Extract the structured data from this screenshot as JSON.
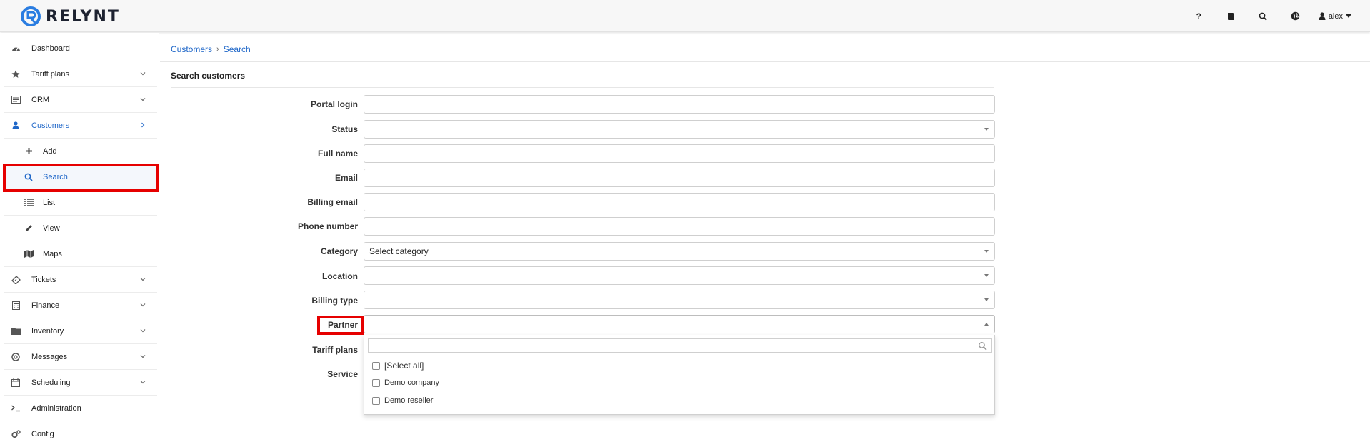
{
  "app": {
    "brand": "RELYNT"
  },
  "topbar": {
    "help": "?",
    "user": "alex"
  },
  "sidebar": {
    "items": [
      {
        "label": "Dashboard"
      },
      {
        "label": "Tariff plans"
      },
      {
        "label": "CRM"
      },
      {
        "label": "Customers"
      },
      {
        "label": "Add"
      },
      {
        "label": "Search"
      },
      {
        "label": "List"
      },
      {
        "label": "View"
      },
      {
        "label": "Maps"
      },
      {
        "label": "Tickets"
      },
      {
        "label": "Finance"
      },
      {
        "label": "Inventory"
      },
      {
        "label": "Messages"
      },
      {
        "label": "Scheduling"
      },
      {
        "label": "Administration"
      },
      {
        "label": "Config"
      }
    ]
  },
  "breadcrumb": {
    "parent": "Customers",
    "current": "Search"
  },
  "form": {
    "title": "Search customers",
    "portal_login": {
      "label": "Portal login",
      "value": ""
    },
    "status": {
      "label": "Status",
      "value": ""
    },
    "full_name": {
      "label": "Full name",
      "value": ""
    },
    "email": {
      "label": "Email",
      "value": ""
    },
    "billing_email": {
      "label": "Billing email",
      "value": ""
    },
    "phone": {
      "label": "Phone number",
      "value": ""
    },
    "category": {
      "label": "Category",
      "value": "Select category"
    },
    "location": {
      "label": "Location",
      "value": ""
    },
    "billing_type": {
      "label": "Billing type",
      "value": ""
    },
    "partner": {
      "label": "Partner",
      "value": ""
    },
    "tariff_plans": {
      "label": "Tariff plans"
    },
    "service": {
      "label": "Service"
    }
  },
  "partner_dropdown": {
    "search_value": "",
    "options": [
      {
        "label": "[Select all]",
        "checked": false
      },
      {
        "label": "Demo company",
        "checked": false
      },
      {
        "label": "Demo reseller",
        "checked": false
      }
    ]
  },
  "colors": {
    "accent": "#1e66c8",
    "highlight": "#e60000"
  }
}
